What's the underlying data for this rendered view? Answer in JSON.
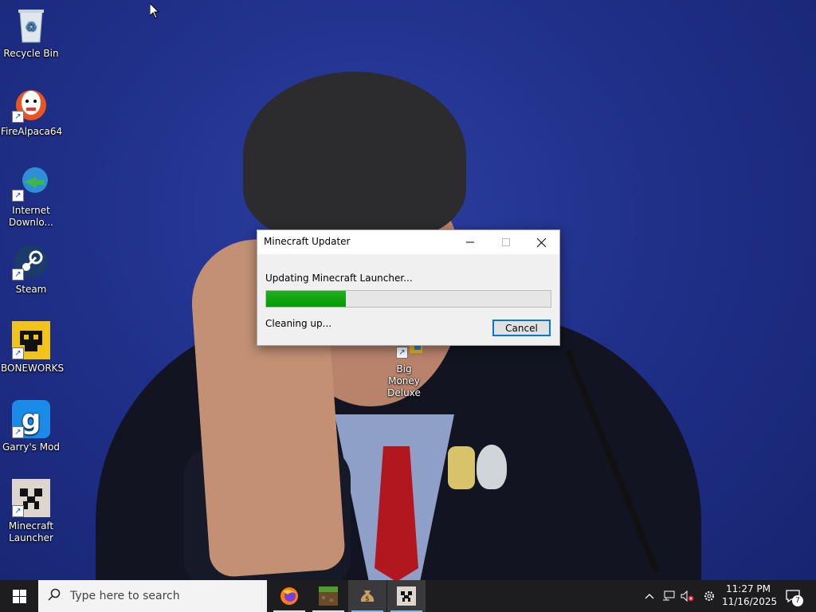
{
  "desktop": {
    "icons": [
      {
        "label": "Recycle Bin"
      },
      {
        "label": "FireAlpaca64"
      },
      {
        "label": "Internet Downlo..."
      },
      {
        "label": "Steam"
      },
      {
        "label": "BONEWORKS"
      },
      {
        "label": "Garry's Mod"
      },
      {
        "label": "Minecraft Launcher"
      },
      {
        "label": "Big Money Deluxe"
      }
    ]
  },
  "dialog": {
    "title": "Minecraft Updater",
    "status": "Updating Minecraft Launcher...",
    "progress_percent": 28,
    "substatus": "Cleaning up...",
    "cancel_label": "Cancel"
  },
  "taskbar": {
    "search_placeholder": "Type here to search",
    "apps": [
      "firefox-icon",
      "minecraft-grass-icon",
      "money-bag-icon",
      "creeper-icon"
    ],
    "clock": {
      "time": "11:27 PM",
      "date": "11/16/2025"
    },
    "notification_count": "7"
  },
  "colors": {
    "progress_fill": "#069a06",
    "taskbar": "#1d1d1f",
    "wallpaper": "#20308a",
    "accent": "#0078d7"
  }
}
